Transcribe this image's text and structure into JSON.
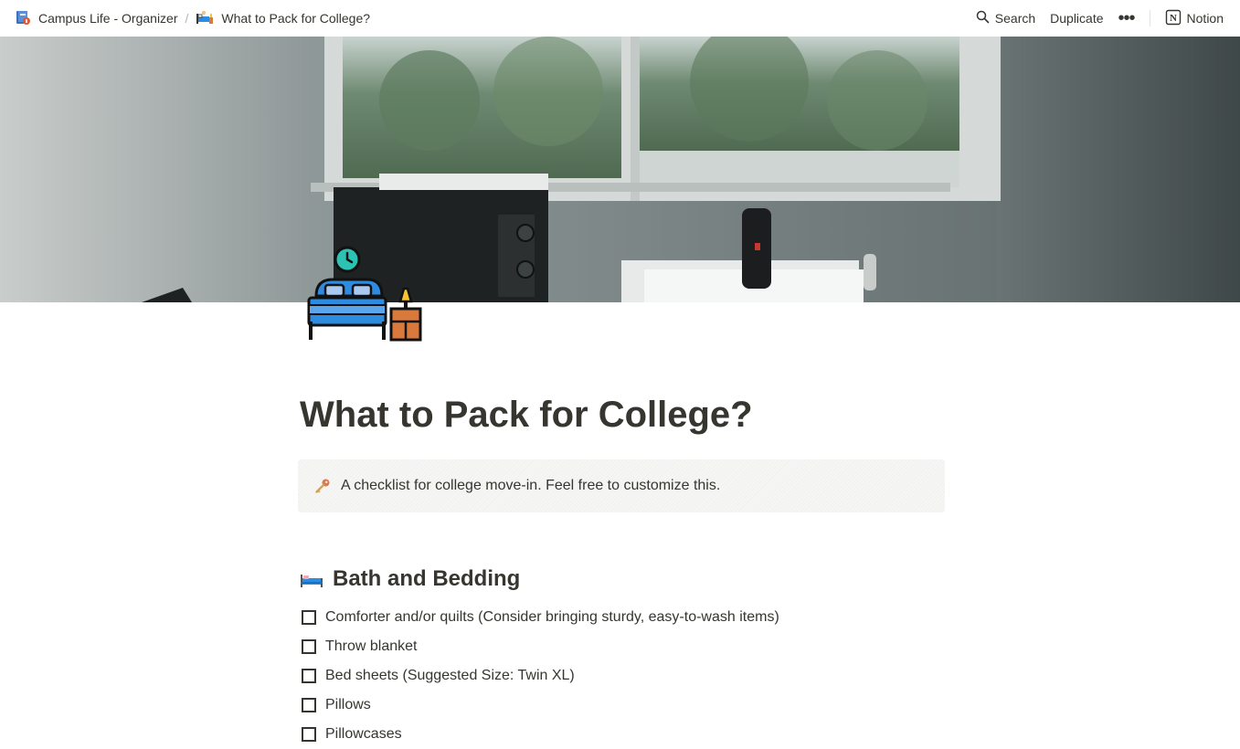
{
  "breadcrumb": {
    "items": [
      {
        "label": "Campus Life - Organizer",
        "icon": "book-icon"
      },
      {
        "label": "What to Pack for College?",
        "icon": "bed-sleeping-icon"
      }
    ],
    "separator": "/"
  },
  "topbar": {
    "search_label": "Search",
    "duplicate_label": "Duplicate",
    "more_label": "•••",
    "notion_label": "Notion"
  },
  "page": {
    "title": "What to Pack for College?",
    "icon": "bed-with-clock-icon",
    "cover": "dorm-window-photo"
  },
  "callout": {
    "icon": "key-icon",
    "text": "A checklist for college move-in. Feel free to customize this."
  },
  "section": {
    "icon": "bed-icon",
    "title": "Bath and Bedding",
    "items": [
      {
        "label": "Comforter and/or quilts (Consider bringing sturdy, easy-to-wash items)",
        "checked": false
      },
      {
        "label": "Throw blanket",
        "checked": false
      },
      {
        "label": "Bed sheets (Suggested Size: Twin XL)",
        "checked": false
      },
      {
        "label": "Pillows",
        "checked": false
      },
      {
        "label": "Pillowcases",
        "checked": false
      }
    ]
  },
  "colors": {
    "text": "#37352f",
    "callout_bg": "#f6f6f5",
    "icon_blue": "#2d8be0",
    "icon_teal": "#2cc3b5"
  }
}
